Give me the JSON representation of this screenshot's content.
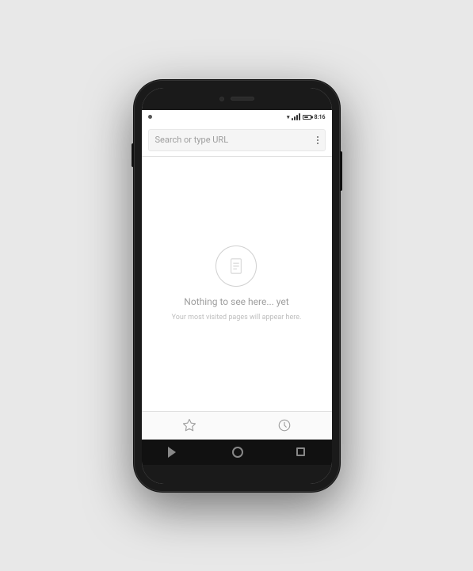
{
  "phone": {
    "status_bar": {
      "time": "8:16",
      "notification_label": "notification"
    },
    "url_bar": {
      "placeholder": "Search or type URL",
      "menu_label": "more-options"
    },
    "browser_content": {
      "empty_state": {
        "icon_label": "document-icon",
        "title": "Nothing to see here... yet",
        "subtitle": "Your most visited pages will appear here."
      }
    },
    "tab_bar": {
      "bookmarks_label": "Bookmarks",
      "history_label": "History"
    },
    "nav_bar": {
      "back_label": "Back",
      "home_label": "Home",
      "recents_label": "Recents"
    }
  }
}
